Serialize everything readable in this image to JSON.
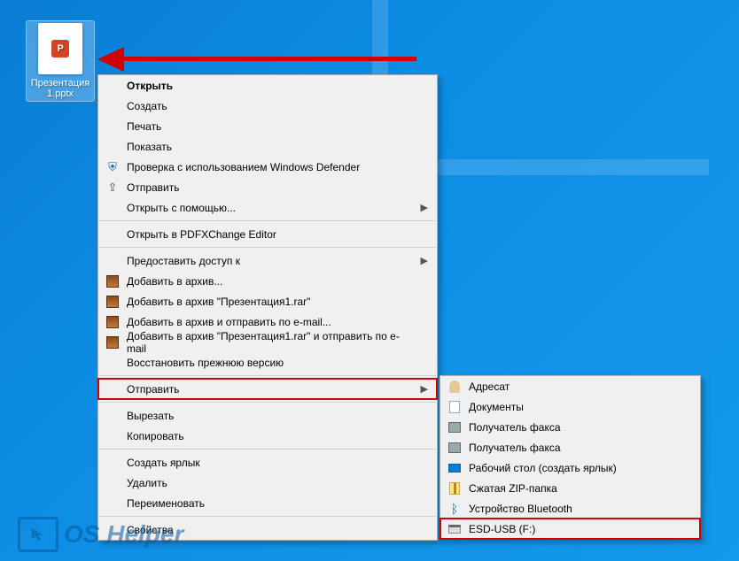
{
  "desktop": {
    "file": {
      "name": "Презентация 1.pptx",
      "badge": "P"
    }
  },
  "context_menu": [
    {
      "type": "item",
      "label": "Открыть",
      "bold": true
    },
    {
      "type": "item",
      "label": "Создать"
    },
    {
      "type": "item",
      "label": "Печать"
    },
    {
      "type": "item",
      "label": "Показать"
    },
    {
      "type": "item",
      "label": "Проверка с использованием Windows Defender",
      "icon": "shield"
    },
    {
      "type": "item",
      "label": "Отправить",
      "icon": "share"
    },
    {
      "type": "item",
      "label": "Открыть с помощью...",
      "submenu": true
    },
    {
      "type": "sep"
    },
    {
      "type": "item",
      "label": "Открыть в PDFXChange Editor"
    },
    {
      "type": "sep"
    },
    {
      "type": "item",
      "label": "Предоставить доступ к",
      "submenu": true
    },
    {
      "type": "item",
      "label": "Добавить в архив...",
      "icon": "rar"
    },
    {
      "type": "item",
      "label": "Добавить в архив \"Презентация1.rar\"",
      "icon": "rar"
    },
    {
      "type": "item",
      "label": "Добавить в архив и отправить по e-mail...",
      "icon": "rar"
    },
    {
      "type": "item",
      "label": "Добавить в архив \"Презентация1.rar\" и отправить по e-mail",
      "icon": "rar"
    },
    {
      "type": "item",
      "label": "Восстановить прежнюю версию"
    },
    {
      "type": "sep"
    },
    {
      "type": "item",
      "label": "Отправить",
      "submenu": true,
      "highlighted": true,
      "expanded": true
    },
    {
      "type": "sep"
    },
    {
      "type": "item",
      "label": "Вырезать"
    },
    {
      "type": "item",
      "label": "Копировать"
    },
    {
      "type": "sep"
    },
    {
      "type": "item",
      "label": "Создать ярлык"
    },
    {
      "type": "item",
      "label": "Удалить"
    },
    {
      "type": "item",
      "label": "Переименовать"
    },
    {
      "type": "sep"
    },
    {
      "type": "item",
      "label": "Свойства"
    }
  ],
  "submenu": [
    {
      "label": "Адресат",
      "icon": "person"
    },
    {
      "label": "Документы",
      "icon": "doc"
    },
    {
      "label": "Получатель факса",
      "icon": "fax"
    },
    {
      "label": "Получатель факса",
      "icon": "fax"
    },
    {
      "label": "Рабочий стол (создать ярлык)",
      "icon": "desk"
    },
    {
      "label": "Сжатая ZIP-папка",
      "icon": "zip"
    },
    {
      "label": "Устройство Bluetooth",
      "icon": "bt"
    },
    {
      "label": "ESD-USB (F:)",
      "icon": "drive",
      "highlighted": true
    }
  ],
  "watermark": {
    "text": "OS Helper"
  }
}
